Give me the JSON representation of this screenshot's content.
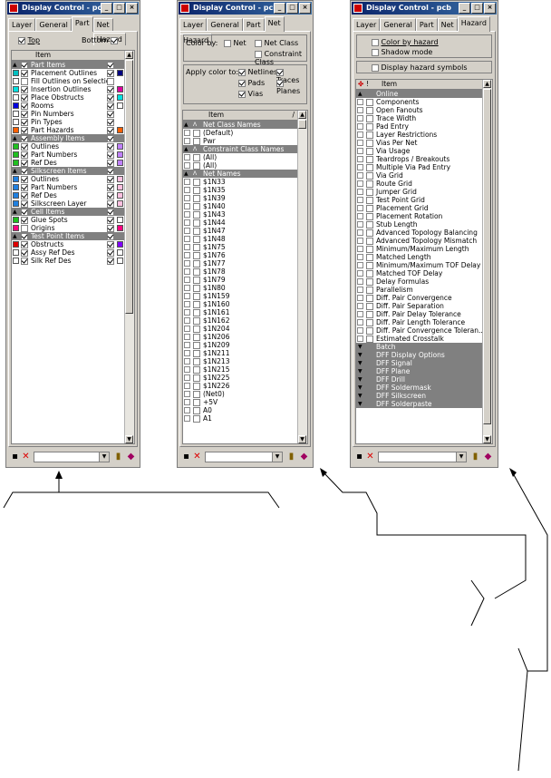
{
  "window_title": "Display Control - pcb",
  "title_buttons": [
    "_",
    "□",
    "×"
  ],
  "tabs": [
    "Layer",
    "General",
    "Part",
    "Net",
    "Hazard"
  ],
  "part_panel": {
    "top_label": "Top",
    "bottom_label": "Bottom",
    "column_header": "Item",
    "rows": [
      {
        "label": "Part Items",
        "type": "group",
        "chk": true,
        "vis": true,
        "color": ""
      },
      {
        "label": "Placement Outlines",
        "type": "item",
        "chk": true,
        "vis": true,
        "color": "#000080",
        "sw": "#00c0c0"
      },
      {
        "label": "Fill Outlines on Selection",
        "type": "item",
        "chk": false,
        "vis": false,
        "color": ""
      },
      {
        "label": "Insertion Outlines",
        "type": "item",
        "chk": true,
        "vis": true,
        "color": "#e000a0",
        "sw": "#00e0e0"
      },
      {
        "label": "Place Obstructs",
        "type": "item",
        "chk": true,
        "vis": true,
        "color": "#00e0e0",
        "sw": "#ffffff"
      },
      {
        "label": "Rooms",
        "type": "item",
        "chk": true,
        "vis": true,
        "color": "#ffffff",
        "sw": "#0000e0"
      },
      {
        "label": "Pin Numbers",
        "type": "item",
        "chk": true,
        "vis": true,
        "color": "",
        "sw": "#ffffff"
      },
      {
        "label": "Pin Types",
        "type": "item",
        "chk": true,
        "vis": true,
        "color": "",
        "sw": "#ffffff"
      },
      {
        "label": "Part Hazards",
        "type": "item",
        "chk": true,
        "vis": true,
        "color": "#ff6000",
        "sw": "#ff6000"
      },
      {
        "label": "Assembly Items",
        "type": "group",
        "chk": true,
        "vis": true,
        "color": ""
      },
      {
        "label": "Outlines",
        "type": "item",
        "chk": true,
        "vis": true,
        "color": "#c080ff",
        "sw": "#20c020"
      },
      {
        "label": "Part Numbers",
        "type": "item",
        "chk": true,
        "vis": true,
        "color": "#c080ff",
        "sw": "#20c020"
      },
      {
        "label": "Ref Des",
        "type": "item",
        "chk": true,
        "vis": true,
        "color": "#c080ff",
        "sw": "#20c020"
      },
      {
        "label": "Silkscreen Items",
        "type": "group",
        "chk": true,
        "vis": true,
        "color": ""
      },
      {
        "label": "Outlines",
        "type": "item",
        "chk": true,
        "vis": true,
        "color": "#ffc0e0",
        "sw": "#2080e0"
      },
      {
        "label": "Part Numbers",
        "type": "item",
        "chk": true,
        "vis": true,
        "color": "#ffc0e0",
        "sw": "#2080e0"
      },
      {
        "label": "Ref Des",
        "type": "item",
        "chk": true,
        "vis": true,
        "color": "#ffc0e0",
        "sw": "#2080e0"
      },
      {
        "label": "Silkscreen Layer",
        "type": "item",
        "chk": true,
        "vis": true,
        "color": "#ffc0e0",
        "sw": "#2080e0"
      },
      {
        "label": "Cell Items",
        "type": "group",
        "chk": true,
        "vis": true,
        "color": ""
      },
      {
        "label": "Glue Spots",
        "type": "item",
        "chk": true,
        "vis": true,
        "color": "#ffffff",
        "sw": "#20c020"
      },
      {
        "label": "Origins",
        "type": "item",
        "chk": false,
        "vis": true,
        "color": "#ff0080",
        "sw": "#ff0080"
      },
      {
        "label": "Test Point Items",
        "type": "group",
        "chk": true,
        "vis": true,
        "color": ""
      },
      {
        "label": "Obstructs",
        "type": "item",
        "chk": true,
        "vis": true,
        "color": "#8000ff",
        "sw": "#e00000"
      },
      {
        "label": "Assy Ref Des",
        "type": "item",
        "chk": true,
        "vis": true,
        "color": "#ffffff",
        "sw": "#ffffff"
      },
      {
        "label": "Silk Ref Des",
        "type": "item",
        "chk": true,
        "vis": true,
        "color": "#ffffff",
        "sw": "#ffffff"
      }
    ]
  },
  "net_panel": {
    "color_by_label": "Color by:",
    "net_label": "Net",
    "net_class_label": "Net Class",
    "constraint_class_label": "Constraint Class",
    "apply_color_label": "Apply color to:",
    "netlines_label": "Netlines",
    "traces_label": "Traces",
    "pads_label": "Pads",
    "planes_label": "Planes",
    "vias_label": "Vias",
    "column_header": "Item",
    "rows": [
      {
        "label": "Net Class Names",
        "type": "group"
      },
      {
        "label": "(Default)",
        "type": "item"
      },
      {
        "label": "Pwr",
        "type": "item"
      },
      {
        "label": "Constraint Class Names",
        "type": "group"
      },
      {
        "label": "(All)",
        "type": "item"
      },
      {
        "label": "(All)",
        "type": "item"
      },
      {
        "label": "Net Names",
        "type": "group"
      },
      {
        "label": "$1N33",
        "type": "item"
      },
      {
        "label": "$1N35",
        "type": "item"
      },
      {
        "label": "$1N39",
        "type": "item"
      },
      {
        "label": "$1N40",
        "type": "item"
      },
      {
        "label": "$1N43",
        "type": "item"
      },
      {
        "label": "$1N44",
        "type": "item"
      },
      {
        "label": "$1N47",
        "type": "item"
      },
      {
        "label": "$1N48",
        "type": "item"
      },
      {
        "label": "$1N75",
        "type": "item"
      },
      {
        "label": "$1N76",
        "type": "item"
      },
      {
        "label": "$1N77",
        "type": "item"
      },
      {
        "label": "$1N78",
        "type": "item"
      },
      {
        "label": "$1N79",
        "type": "item"
      },
      {
        "label": "$1N80",
        "type": "item"
      },
      {
        "label": "$1N159",
        "type": "item"
      },
      {
        "label": "$1N160",
        "type": "item"
      },
      {
        "label": "$1N161",
        "type": "item"
      },
      {
        "label": "$1N162",
        "type": "item"
      },
      {
        "label": "$1N204",
        "type": "item"
      },
      {
        "label": "$1N206",
        "type": "item"
      },
      {
        "label": "$1N209",
        "type": "item"
      },
      {
        "label": "$1N211",
        "type": "item"
      },
      {
        "label": "$1N213",
        "type": "item"
      },
      {
        "label": "$1N215",
        "type": "item"
      },
      {
        "label": "$1N225",
        "type": "item"
      },
      {
        "label": "$1N226",
        "type": "item"
      },
      {
        "label": "(Net0)",
        "type": "item"
      },
      {
        "label": "+5V",
        "type": "item"
      },
      {
        "label": "A0",
        "type": "item"
      },
      {
        "label": "A1",
        "type": "item"
      }
    ]
  },
  "hazard_panel": {
    "color_by_hazard_label": "Color by hazard",
    "shadow_mode_label": "Shadow mode",
    "display_symbols_label": "Display hazard symbols",
    "column_header": "Item",
    "rows": [
      {
        "label": "Online",
        "type": "group"
      },
      {
        "label": "Components",
        "type": "item"
      },
      {
        "label": "Open Fanouts",
        "type": "item"
      },
      {
        "label": "Trace Width",
        "type": "item"
      },
      {
        "label": "Pad Entry",
        "type": "item"
      },
      {
        "label": "Layer Restrictions",
        "type": "item"
      },
      {
        "label": "Vias Per Net",
        "type": "item"
      },
      {
        "label": "Via Usage",
        "type": "item"
      },
      {
        "label": "Teardrops / Breakouts",
        "type": "item"
      },
      {
        "label": "Multiple Via Pad Entry",
        "type": "item"
      },
      {
        "label": "Via Grid",
        "type": "item"
      },
      {
        "label": "Route Grid",
        "type": "item"
      },
      {
        "label": "Jumper Grid",
        "type": "item"
      },
      {
        "label": "Test Point Grid",
        "type": "item"
      },
      {
        "label": "Placement Grid",
        "type": "item"
      },
      {
        "label": "Placement Rotation",
        "type": "item"
      },
      {
        "label": "Stub Length",
        "type": "item"
      },
      {
        "label": "Advanced Topology Balancing",
        "type": "item"
      },
      {
        "label": "Advanced Topology Mismatch",
        "type": "item"
      },
      {
        "label": "Minimum/Maximum Length",
        "type": "item"
      },
      {
        "label": "Matched Length",
        "type": "item"
      },
      {
        "label": "Minimum/Maximum TOF Delay",
        "type": "item"
      },
      {
        "label": "Matched TOF Delay",
        "type": "item"
      },
      {
        "label": "Delay Formulas",
        "type": "item"
      },
      {
        "label": "Parallelism",
        "type": "item"
      },
      {
        "label": "Diff. Pair Convergence",
        "type": "item"
      },
      {
        "label": "Diff. Pair Separation",
        "type": "item"
      },
      {
        "label": "Diff. Pair Delay Tolerance",
        "type": "item"
      },
      {
        "label": "Diff. Pair Length Tolerance",
        "type": "item"
      },
      {
        "label": "Diff. Pair Convergence Toleran...",
        "type": "item"
      },
      {
        "label": "Estimated Crosstalk",
        "type": "item"
      },
      {
        "label": "Batch",
        "type": "group"
      },
      {
        "label": "DFF Display Options",
        "type": "group"
      },
      {
        "label": "DFF Signal",
        "type": "group"
      },
      {
        "label": "DFF Plane",
        "type": "group"
      },
      {
        "label": "DFF Drill",
        "type": "group"
      },
      {
        "label": "DFF Soldermask",
        "type": "group"
      },
      {
        "label": "DFF Silkscreen",
        "type": "group"
      },
      {
        "label": "DFF Solderpaste",
        "type": "group"
      }
    ]
  }
}
